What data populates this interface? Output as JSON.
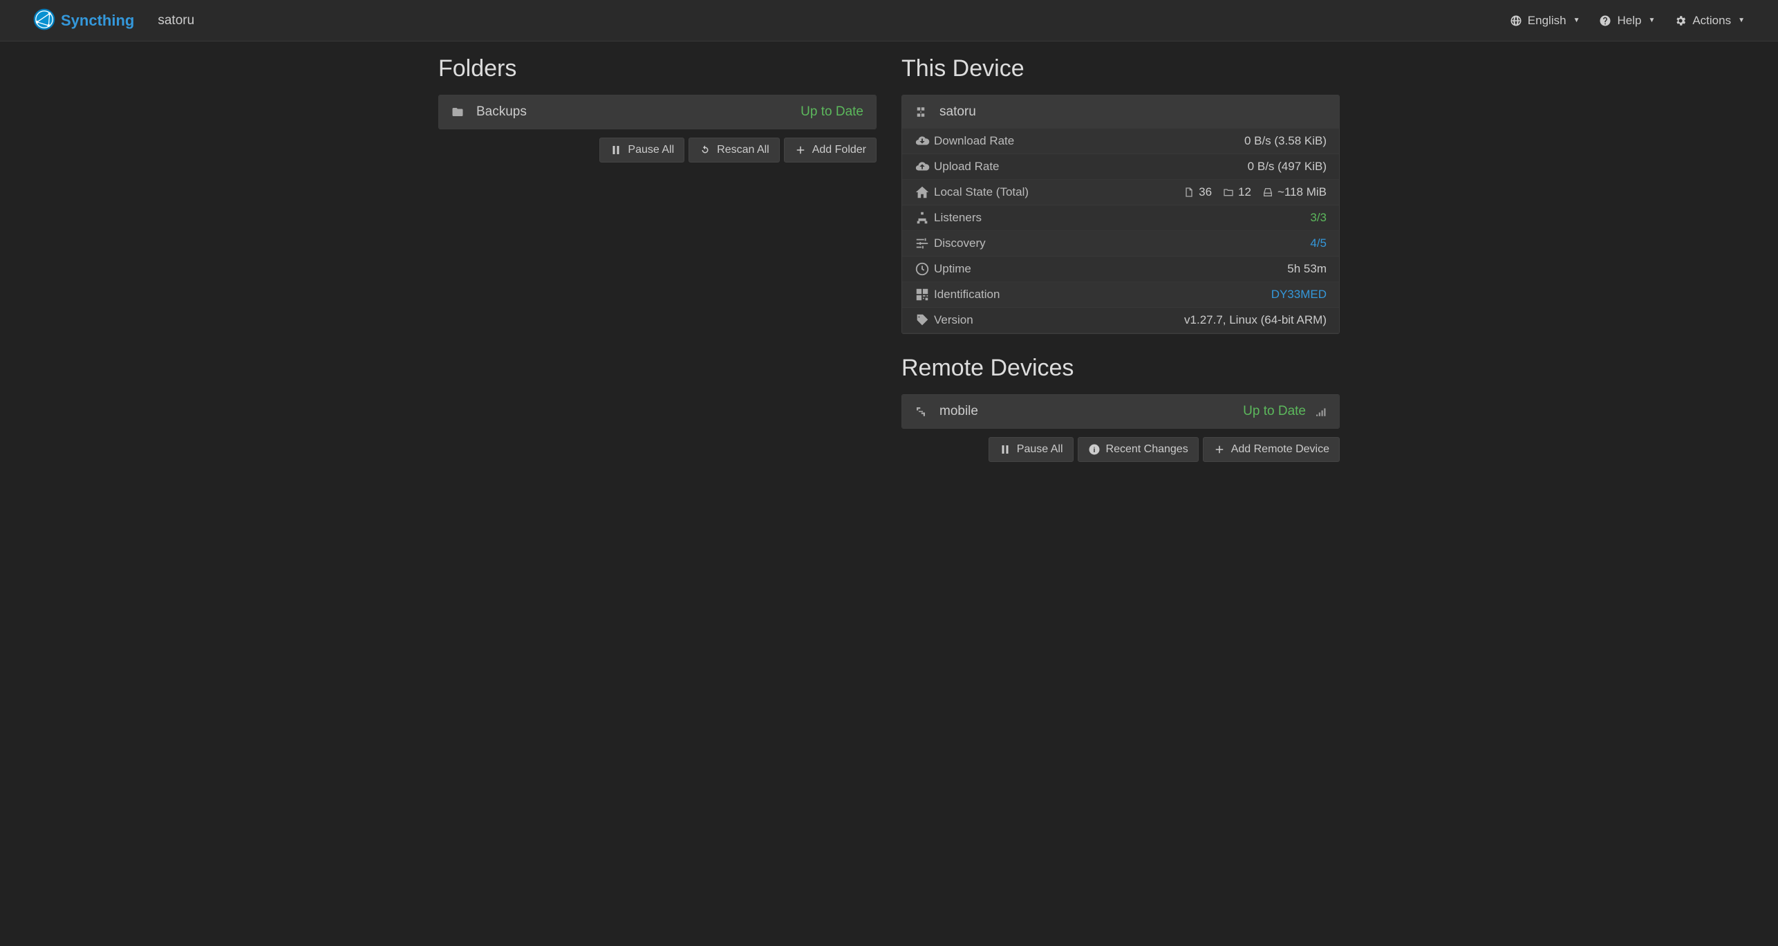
{
  "navbar": {
    "brand": "Syncthing",
    "host": "satoru",
    "menu": {
      "language": "English",
      "help": "Help",
      "actions": "Actions"
    }
  },
  "folders": {
    "heading": "Folders",
    "items": [
      {
        "name": "Backups",
        "status": "Up to Date"
      }
    ],
    "buttons": {
      "pause_all": "Pause All",
      "rescan_all": "Rescan All",
      "add_folder": "Add Folder"
    }
  },
  "this_device": {
    "heading": "This Device",
    "name": "satoru",
    "stats": {
      "download_rate": {
        "label": "Download Rate",
        "value": "0 B/s (3.58 KiB)"
      },
      "upload_rate": {
        "label": "Upload Rate",
        "value": "0 B/s (497 KiB)"
      },
      "local_state": {
        "label": "Local State (Total)",
        "files": "36",
        "dirs": "12",
        "size": "~118 MiB"
      },
      "listeners": {
        "label": "Listeners",
        "value": "3/3"
      },
      "discovery": {
        "label": "Discovery",
        "value": "4/5"
      },
      "uptime": {
        "label": "Uptime",
        "value": "5h 53m"
      },
      "identification": {
        "label": "Identification",
        "value": "DY33MED"
      },
      "version": {
        "label": "Version",
        "value": "v1.27.7, Linux (64-bit ARM)"
      }
    }
  },
  "remote_devices": {
    "heading": "Remote Devices",
    "items": [
      {
        "name": "mobile",
        "status": "Up to Date"
      }
    ],
    "buttons": {
      "pause_all": "Pause All",
      "recent_changes": "Recent Changes",
      "add_remote_device": "Add Remote Device"
    }
  }
}
